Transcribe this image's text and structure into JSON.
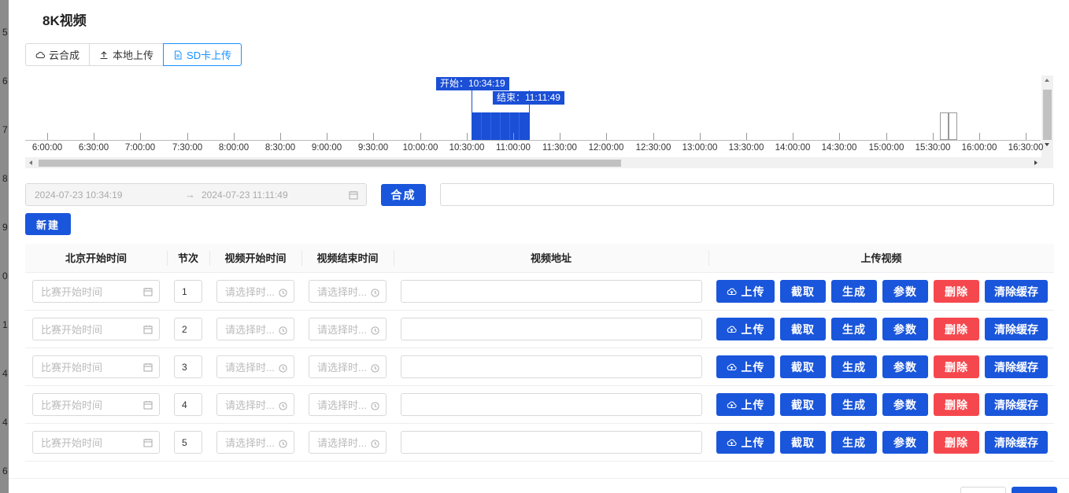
{
  "background": {
    "side_numbers": [
      "5",
      "6",
      "7",
      "8",
      "9",
      "0",
      "1",
      "4",
      "4",
      "6"
    ]
  },
  "dialog": {
    "title": "8K视频"
  },
  "tabs": [
    {
      "label": "云合成",
      "icon": "cloud-icon",
      "active": false
    },
    {
      "label": "本地上传",
      "icon": "upload-icon",
      "active": false
    },
    {
      "label": "SD卡上传",
      "icon": "file-icon",
      "active": true
    }
  ],
  "timeline": {
    "ticks": [
      "6:00:00",
      "6:30:00",
      "7:00:00",
      "7:30:00",
      "8:00:00",
      "8:30:00",
      "9:00:00",
      "9:30:00",
      "10:00:00",
      "10:30:00",
      "11:00:00",
      "11:30:00",
      "12:00:00",
      "12:30:00",
      "13:00:00",
      "13:30:00",
      "14:00:00",
      "14:30:00",
      "15:00:00",
      "15:30:00",
      "16:00:00",
      "16:30:00"
    ],
    "start_flag": "开始：10:34:19",
    "end_flag": "结束：11:11:49",
    "selection_start": "10:34:19",
    "selection_end": "11:11:49"
  },
  "range": {
    "start": "2024-07-23 10:34:19",
    "separator": "→",
    "end": "2024-07-23 11:11:49"
  },
  "compose_button": "合成",
  "url_value": "",
  "new_button": "新建",
  "table": {
    "headers": [
      "北京开始时间",
      "节次",
      "视频开始时间",
      "视频结束时间",
      "视频地址",
      "上传视频"
    ],
    "date_placeholder": "比赛开始时间",
    "time_placeholder": "请选择时...",
    "actions": {
      "upload": "上传",
      "capture": "截取",
      "generate": "生成",
      "params": "参数",
      "delete": "删除",
      "clear_cache": "清除缓存"
    },
    "rows": [
      {
        "section": "1",
        "url": ""
      },
      {
        "section": "2",
        "url": ""
      },
      {
        "section": "3",
        "url": ""
      },
      {
        "section": "4",
        "url": ""
      },
      {
        "section": "5",
        "url": ""
      }
    ]
  },
  "colors": {
    "primary": "#1a56db",
    "danger": "#f5484e",
    "timeline_selection": "#1a4fd6",
    "active_tab": "#1890ff"
  }
}
